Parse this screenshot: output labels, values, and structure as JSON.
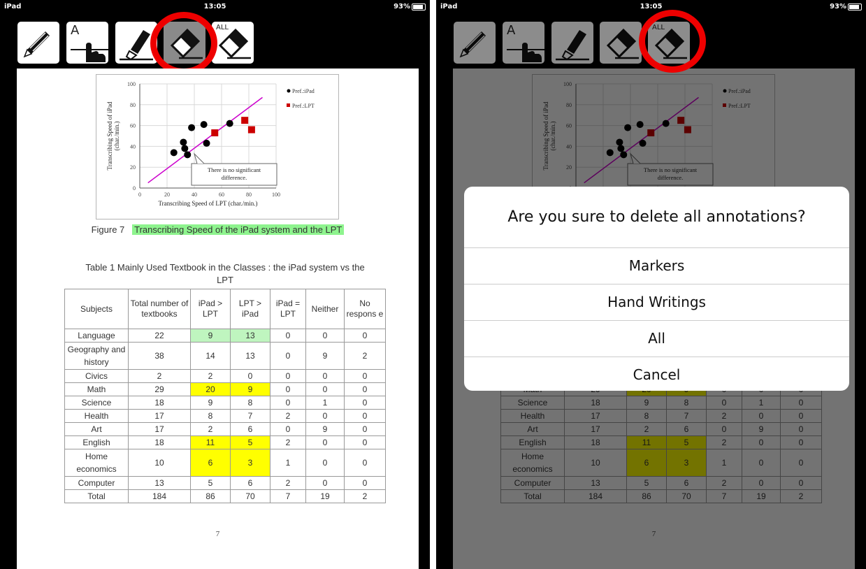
{
  "status_bar": {
    "carrier": "iPad",
    "time": "13:05",
    "battery": "93%"
  },
  "toolbar": {
    "tools": [
      {
        "name": "pen-tool",
        "label": ""
      },
      {
        "name": "text-tool",
        "label": "A"
      },
      {
        "name": "marker-tool",
        "label": ""
      },
      {
        "name": "eraser-tool",
        "label": ""
      },
      {
        "name": "eraser-all-tool",
        "label": "ALL"
      }
    ]
  },
  "figure": {
    "caption_prefix": "Figure 7",
    "caption_highlight": "Transcribing Speed of the iPad system and the LPT",
    "chart_data": {
      "type": "scatter",
      "xlabel": "Transcribing Speed of LPT (char./min.)",
      "ylabel": "Transcribing Speed of iPad (char./min.)",
      "xlim": [
        0,
        100
      ],
      "ylim": [
        0,
        100
      ],
      "x_ticks": [
        "0",
        "20",
        "40",
        "60",
        "80",
        "100"
      ],
      "y_ticks": [
        "0",
        "20",
        "40",
        "60",
        "80",
        "100"
      ],
      "grid": true,
      "legend_position": "top-right",
      "series": [
        {
          "name": "Pref.:iPad",
          "marker": "circle",
          "color": "#000000",
          "points": [
            [
              25,
              34
            ],
            [
              32,
              44
            ],
            [
              33,
              38
            ],
            [
              35,
              32
            ],
            [
              38,
              58
            ],
            [
              47,
              61
            ],
            [
              49,
              43
            ],
            [
              66,
              62
            ]
          ]
        },
        {
          "name": "Pref.:LPT",
          "marker": "square",
          "color": "#cc0000",
          "points": [
            [
              55,
              53
            ],
            [
              77,
              65
            ],
            [
              82,
              56
            ]
          ]
        }
      ],
      "trendline": {
        "color": "#cc00cc",
        "points": [
          [
            6,
            5
          ],
          [
            90,
            87
          ]
        ]
      },
      "annotation": "There is no significant difference."
    }
  },
  "table": {
    "caption": "Table 1   Mainly Used Textbook in the Classes : the iPad system vs the LPT",
    "headers": [
      "Subjects",
      "Total number of textbooks",
      "iPad > LPT",
      "LPT > iPad",
      "iPad = LPT",
      "Neither",
      "No respons e"
    ],
    "rows": [
      [
        "Language",
        "22",
        "9",
        "13",
        "0",
        "0",
        "0"
      ],
      [
        "Geography and history",
        "38",
        "14",
        "13",
        "0",
        "9",
        "2"
      ],
      [
        "Civics",
        "2",
        "2",
        "0",
        "0",
        "0",
        "0"
      ],
      [
        "Math",
        "29",
        "20",
        "9",
        "0",
        "0",
        "0"
      ],
      [
        "Science",
        "18",
        "9",
        "8",
        "0",
        "1",
        "0"
      ],
      [
        "Health",
        "17",
        "8",
        "7",
        "2",
        "0",
        "0"
      ],
      [
        "Art",
        "17",
        "2",
        "6",
        "0",
        "9",
        "0"
      ],
      [
        "English",
        "18",
        "11",
        "5",
        "2",
        "0",
        "0"
      ],
      [
        "Home economics",
        "10",
        "6",
        "3",
        "1",
        "0",
        "0"
      ],
      [
        "Computer",
        "13",
        "5",
        "6",
        "2",
        "0",
        "0"
      ],
      [
        "Total",
        "184",
        "86",
        "70",
        "7",
        "19",
        "2"
      ]
    ],
    "highlights": [
      {
        "row": 0,
        "col": 2,
        "color": "green"
      },
      {
        "row": 0,
        "col": 3,
        "color": "green"
      },
      {
        "row": 3,
        "col": 2,
        "color": "yellow"
      },
      {
        "row": 3,
        "col": 3,
        "color": "yellow"
      },
      {
        "row": 7,
        "col": 2,
        "color": "yellow"
      },
      {
        "row": 7,
        "col": 3,
        "color": "yellow"
      },
      {
        "row": 8,
        "col": 2,
        "color": "yellow"
      },
      {
        "row": 8,
        "col": 3,
        "color": "yellow"
      }
    ]
  },
  "page_number": "7",
  "dialog": {
    "title": "Are you sure to delete all annotations?",
    "options": [
      "Markers",
      "Hand Writings",
      "All",
      "Cancel"
    ]
  }
}
